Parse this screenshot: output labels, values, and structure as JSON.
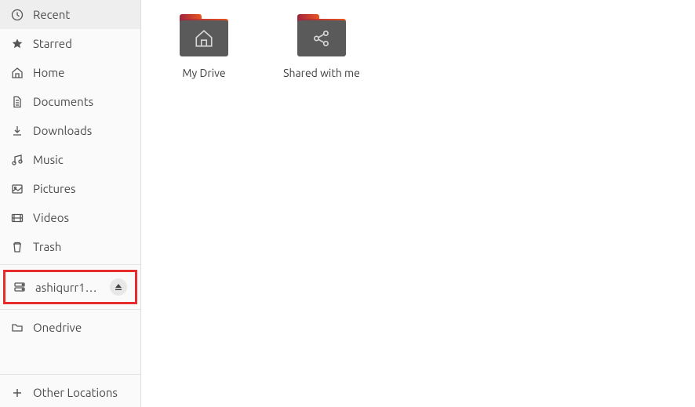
{
  "sidebar": {
    "items": [
      {
        "label": "Recent"
      },
      {
        "label": "Starred"
      },
      {
        "label": "Home"
      },
      {
        "label": "Documents"
      },
      {
        "label": "Downloads"
      },
      {
        "label": "Music"
      },
      {
        "label": "Pictures"
      },
      {
        "label": "Videos"
      },
      {
        "label": "Trash"
      }
    ],
    "mount": {
      "label": "ashiqurr11…"
    },
    "bookmarks": [
      {
        "label": "Onedrive"
      }
    ],
    "other": {
      "label": "Other Locations"
    }
  },
  "main": {
    "folders": [
      {
        "label": "My Drive",
        "glyph": "home"
      },
      {
        "label": "Shared with me",
        "glyph": "share"
      }
    ]
  }
}
